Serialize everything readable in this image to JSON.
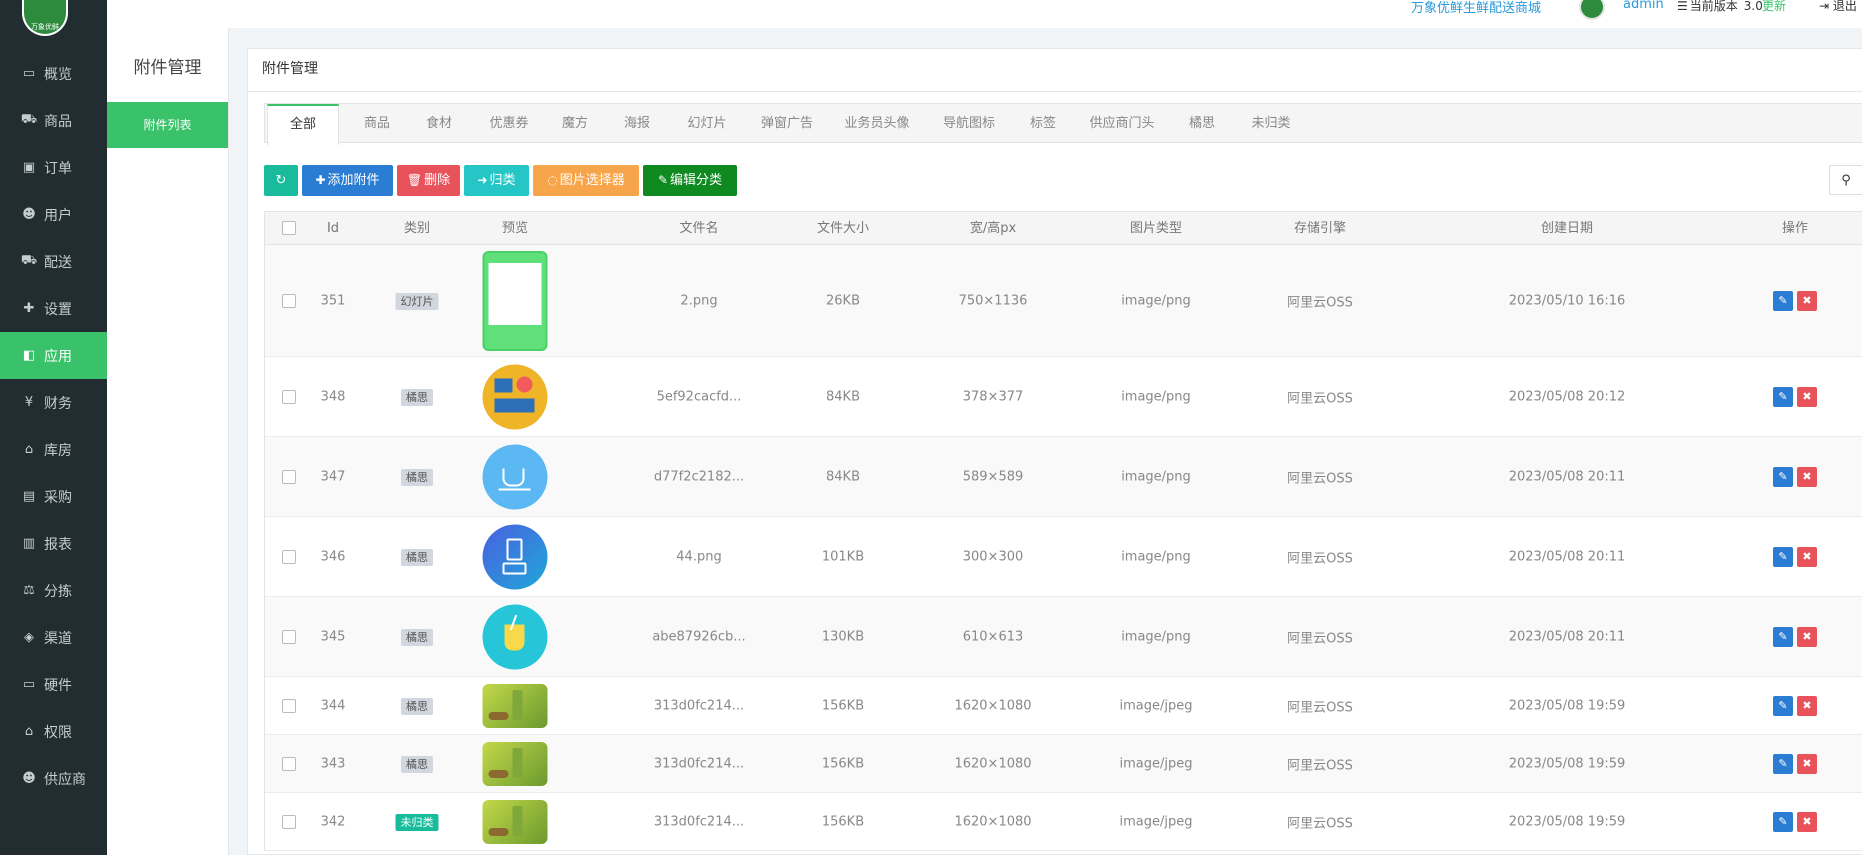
{
  "brand": {
    "logo_text": "万象优鲜"
  },
  "sidebar": {
    "items": [
      {
        "label": "概览",
        "icon": "monitor-icon",
        "glyph": "▭"
      },
      {
        "label": "商品",
        "icon": "cart-icon",
        "glyph": "⛟"
      },
      {
        "label": "订单",
        "icon": "order-icon",
        "glyph": "▣"
      },
      {
        "label": "用户",
        "icon": "users-icon",
        "glyph": "☻"
      },
      {
        "label": "配送",
        "icon": "truck-icon",
        "glyph": "⛟"
      },
      {
        "label": "设置",
        "icon": "puzzle-icon",
        "glyph": "✚"
      },
      {
        "label": "应用",
        "icon": "grid-icon",
        "glyph": "◧",
        "active": true
      },
      {
        "label": "财务",
        "icon": "yen-icon",
        "glyph": "¥"
      },
      {
        "label": "库房",
        "icon": "home-icon",
        "glyph": "⌂"
      },
      {
        "label": "采购",
        "icon": "bus-icon",
        "glyph": "▤"
      },
      {
        "label": "报表",
        "icon": "bar-chart-icon",
        "glyph": "▥"
      },
      {
        "label": "分拣",
        "icon": "balance-icon",
        "glyph": "⚖"
      },
      {
        "label": "渠道",
        "icon": "cube-icon",
        "glyph": "◈"
      },
      {
        "label": "硬件",
        "icon": "desktop-icon",
        "glyph": "▭"
      },
      {
        "label": "权限",
        "icon": "bank-icon",
        "glyph": "⌂"
      },
      {
        "label": "供应商",
        "icon": "users-icon",
        "glyph": "☻"
      }
    ]
  },
  "subbar": {
    "title": "附件管理",
    "item": "附件列表"
  },
  "header": {
    "link": "万象优鲜生鲜配送商城",
    "user": "admin",
    "version_label": "当前版本",
    "version": "3.0",
    "update": "更新",
    "logout": "退出"
  },
  "panel": {
    "title": "附件管理"
  },
  "tabs": [
    "全部",
    "商品",
    "食材",
    "优惠券",
    "魔方",
    "海报",
    "幻灯片",
    "弹窗广告",
    "业务员头像",
    "导航图标",
    "标签",
    "供应商门头",
    "橘思",
    "未归类"
  ],
  "toolbar": {
    "refresh": "↻",
    "add": "添加附件",
    "delete": "删除",
    "classify": "归类",
    "picker": "图片选择器",
    "edit_category": "编辑分类"
  },
  "colors": {
    "accent": "#3ac26a",
    "sidebar_bg": "#222d32",
    "blue": "#2b7cd3",
    "red": "#e8525a",
    "teal": "#18bc9c",
    "orange": "#f7a54a",
    "green_dark": "#0f8a20"
  },
  "table": {
    "headers": [
      "Id",
      "类别",
      "预览",
      "文件名",
      "文件大小",
      "宽/高px",
      "图片类型",
      "存储引擎",
      "创建日期",
      "操作"
    ],
    "rows": [
      {
        "id": "351",
        "category": "幻灯片",
        "thumb": "slide",
        "file": "2.png",
        "size": "26KB",
        "dims": "750×1136",
        "type": "image/png",
        "engine": "阿里云OSS",
        "date": "2023/05/10 16:16"
      },
      {
        "id": "348",
        "category": "橘思",
        "thumb": "icons",
        "file": "5ef92cacfd...",
        "size": "84KB",
        "dims": "378×377",
        "type": "image/png",
        "engine": "阿里云OSS",
        "date": "2023/05/08 20:12"
      },
      {
        "id": "347",
        "category": "橘思",
        "thumb": "coffee",
        "file": "d77f2c2182...",
        "size": "84KB",
        "dims": "589×589",
        "type": "image/png",
        "engine": "阿里云OSS",
        "date": "2023/05/08 20:11"
      },
      {
        "id": "346",
        "category": "橘思",
        "thumb": "blender",
        "file": "44.png",
        "size": "101KB",
        "dims": "300×300",
        "type": "image/png",
        "engine": "阿里云OSS",
        "date": "2023/05/08 20:11"
      },
      {
        "id": "345",
        "category": "橘思",
        "thumb": "juice",
        "file": "abe87926cb...",
        "size": "130KB",
        "dims": "610×613",
        "type": "image/png",
        "engine": "阿里云OSS",
        "date": "2023/05/08 20:11"
      },
      {
        "id": "344",
        "category": "橘思",
        "thumb": "photo",
        "file": "313d0fc214...",
        "size": "156KB",
        "dims": "1620×1080",
        "type": "image/jpeg",
        "engine": "阿里云OSS",
        "date": "2023/05/08 19:59"
      },
      {
        "id": "343",
        "category": "橘思",
        "thumb": "photo",
        "file": "313d0fc214...",
        "size": "156KB",
        "dims": "1620×1080",
        "type": "image/jpeg",
        "engine": "阿里云OSS",
        "date": "2023/05/08 19:59"
      },
      {
        "id": "342",
        "category": "未归类",
        "thumb": "photo",
        "file": "313d0fc214...",
        "size": "156KB",
        "dims": "1620×1080",
        "type": "image/jpeg",
        "engine": "阿里云OSS",
        "date": "2023/05/08 19:59"
      }
    ]
  }
}
